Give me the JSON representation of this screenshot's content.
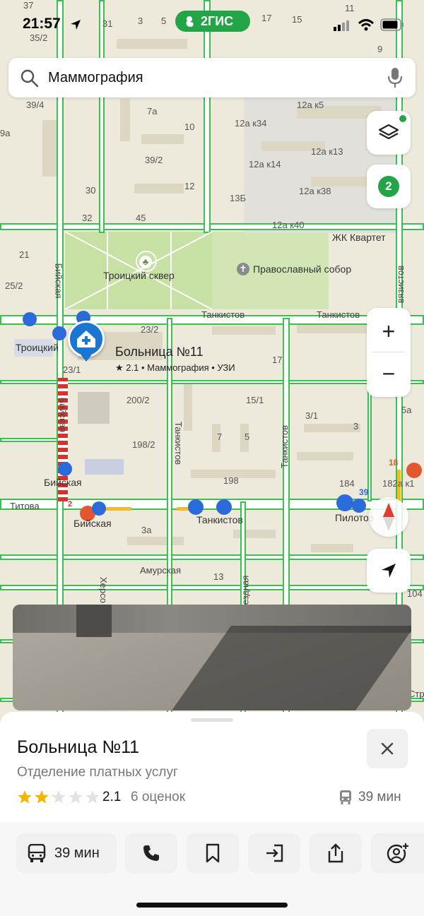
{
  "status_bar": {
    "time": "21:57",
    "brand": "2ГИС"
  },
  "search": {
    "query": "Маммография"
  },
  "map_controls": {
    "filter_count": "2",
    "zoom_in": "+",
    "zoom_out": "−"
  },
  "map": {
    "place_name": "Больница №11",
    "place_meta": "★ 2.1 • Маммография • УЗИ",
    "labels": {
      "park": "Троицкий сквер",
      "cathedral": "Православный собор",
      "complex": "ЖК Квартет",
      "stop_troitsky": "Троицкий",
      "stop_biyskaya_1": "Бийская",
      "stop_biyskaya_2": "Бийская",
      "stop_tankistov": "Танкистов",
      "stop_pilotov": "Пилотов"
    },
    "streets": {
      "tankistov_h1": "Танкистов",
      "tankistov_h2": "Танкистов",
      "tankistov_v1": "Танкистов",
      "tankistov_v2": "Танкистов",
      "biyskaya_v1": "Бийская",
      "biyskaya_v2": "Бийская",
      "titova": "Титова",
      "amurskaya": "Амурская",
      "kherson": "Херсо",
      "zvezdnaya": "ездная",
      "svyazistov": "вязистов",
      "stroit": "Стр"
    },
    "house_numbers": [
      "37",
      "31",
      "3",
      "5",
      "17",
      "15",
      "11",
      "35/2",
      "9",
      "39/4",
      "7а",
      "12а к5",
      "12а к34",
      "10",
      "9а",
      "39/2",
      "12а к13",
      "12а к14",
      "12",
      "30",
      "12а к38",
      "13Б",
      "32",
      "45",
      "12а к40",
      "21",
      "25/2",
      "23/2",
      "17",
      "23/1",
      "200/2",
      "15/1",
      "3/1",
      "5а",
      "198/2",
      "7",
      "5",
      "3",
      "198",
      "184",
      "182а к1",
      "3а",
      "13",
      "104"
    ],
    "route_badges": {
      "r2": "2",
      "r18": "18",
      "r39": "39"
    }
  },
  "card": {
    "title": "Больница №11",
    "subtitle": "Отделение платных услуг",
    "rating": "2.1",
    "rating_value": 2.1,
    "reviews": "6 оценок",
    "transit_time": "39 мин"
  },
  "actions": {
    "route_label": "39 мин"
  },
  "colors": {
    "accent_green": "#22a447",
    "road_green": "#37c14e",
    "place_blue": "#1976d2",
    "star": "#f5b400"
  }
}
